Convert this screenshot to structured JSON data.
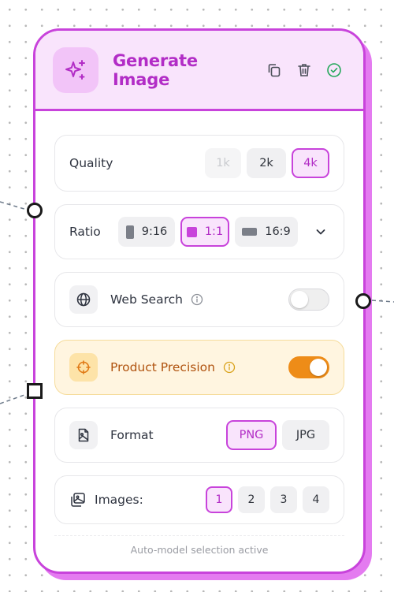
{
  "colors": {
    "accent": "#c843db",
    "accent_text": "#b22dc6",
    "header_bg": "#f9e4fc",
    "amber_bg": "#fff5e0",
    "toggle_on": "#ee8c18",
    "success": "#23a85a"
  },
  "header": {
    "title": "Generate Image",
    "icon": "sparkles-icon",
    "actions": [
      "copy-icon",
      "trash-icon",
      "check-circle-icon"
    ]
  },
  "quality": {
    "label": "Quality",
    "options": [
      "1k",
      "2k",
      "4k"
    ],
    "selected": "4k",
    "disabled": [
      "1k"
    ]
  },
  "ratio": {
    "label": "Ratio",
    "options": [
      "9:16",
      "1:1",
      "16:9"
    ],
    "selected": "1:1",
    "more_icon": "chevron-down-icon"
  },
  "web_search": {
    "label": "Web Search",
    "icon": "globe-icon",
    "info_icon": "info-icon",
    "enabled": false
  },
  "product_precision": {
    "label": "Product Precision",
    "icon": "crosshair-icon",
    "info_icon": "info-icon",
    "enabled": true
  },
  "format": {
    "label": "Format",
    "icon": "image-file-icon",
    "options": [
      "PNG",
      "JPG"
    ],
    "selected": "PNG"
  },
  "images": {
    "label": "Images:",
    "icon": "images-icon",
    "options": [
      "1",
      "2",
      "3",
      "4"
    ],
    "selected": "1"
  },
  "footer": {
    "status": "Auto-model selection active"
  }
}
